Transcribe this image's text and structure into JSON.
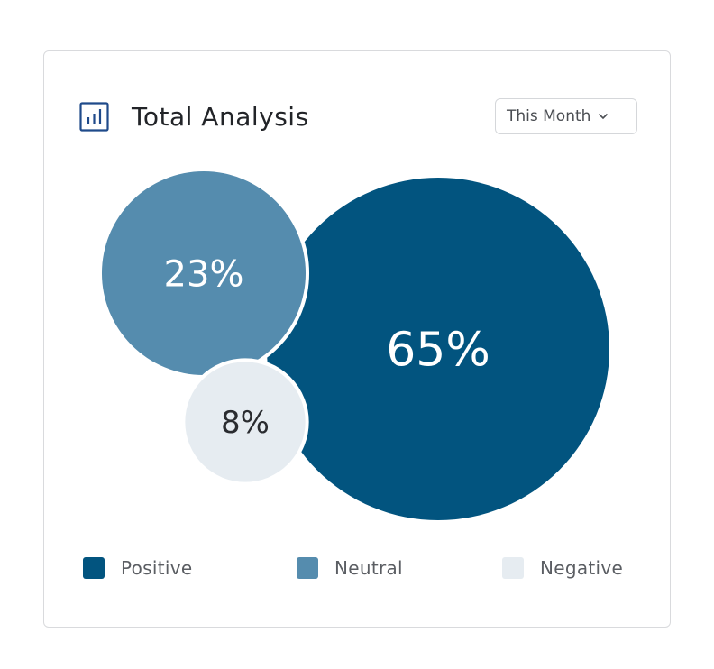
{
  "header": {
    "title": "Total Analysis",
    "icon": "bar-chart-icon"
  },
  "filter": {
    "selected": "This Month",
    "icon": "chevron-down-icon"
  },
  "colors": {
    "positive": "#02547f",
    "neutral": "#558cae",
    "negative": "#e6ecf1",
    "dark_text": "#2a2c30"
  },
  "chart_data": {
    "type": "bubble",
    "series": [
      {
        "name": "Positive",
        "value": 65,
        "label": "65%"
      },
      {
        "name": "Neutral",
        "value": 23,
        "label": "23%"
      },
      {
        "name": "Negative",
        "value": 8,
        "label": "8%"
      }
    ],
    "legend_position": "bottom"
  },
  "legend": [
    {
      "label": "Positive"
    },
    {
      "label": "Neutral"
    },
    {
      "label": "Negative"
    }
  ]
}
